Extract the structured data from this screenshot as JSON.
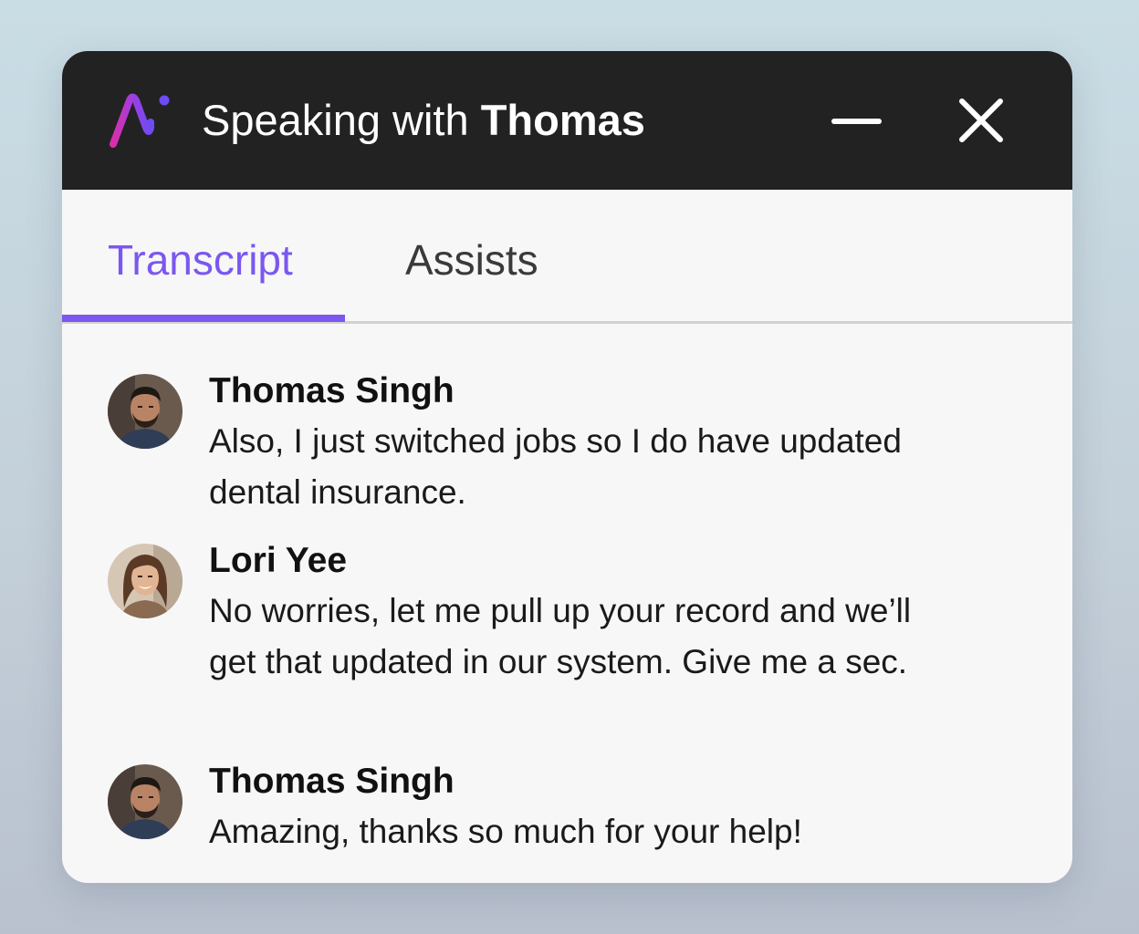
{
  "window": {
    "title_prefix": "Speaking with",
    "title_name": "Thomas",
    "logo_icon": "ni-logo-icon",
    "minimize_icon": "minimize-icon",
    "close_icon": "close-icon"
  },
  "tabs": [
    {
      "label": "Transcript",
      "active": true
    },
    {
      "label": "Assists",
      "active": false
    }
  ],
  "colors": {
    "accent": "#7b57f0",
    "titlebar": "#222222",
    "panel": "#f7f7f7"
  },
  "messages": [
    {
      "speaker": "Thomas Singh",
      "text": "Also, I just switched jobs so I do have updated dental insurance.",
      "avatar_icon": "male-avatar-icon"
    },
    {
      "speaker": "Lori Yee",
      "text": "No worries, let me pull up your record and we’ll get that updated in our system. Give me a sec.",
      "avatar_icon": "female-avatar-icon"
    },
    {
      "speaker": "Thomas Singh",
      "text": "Amazing, thanks so much for your help!",
      "avatar_icon": "male-avatar-icon"
    }
  ]
}
